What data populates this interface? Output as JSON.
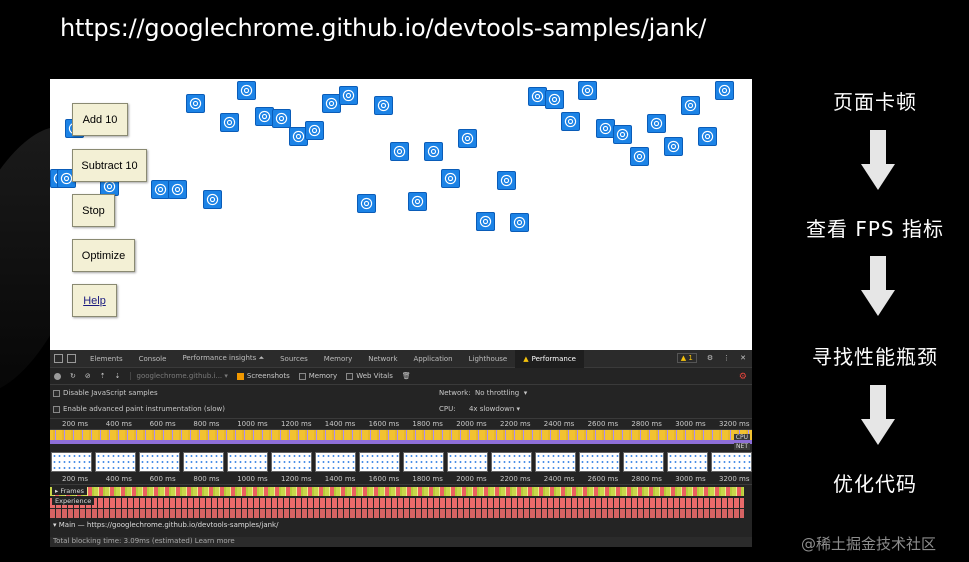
{
  "slide": {
    "url": "https://googlechrome.github.io/devtools-samples/jank/",
    "watermark": "@稀土掘金技术社区"
  },
  "demo": {
    "buttons": [
      "Add 10",
      "Subtract 10",
      "Stop",
      "Optimize",
      "Help"
    ]
  },
  "devtools": {
    "tabs": [
      "Elements",
      "Console",
      "Performance insights ⏶",
      "Sources",
      "Memory",
      "Network",
      "Application",
      "Lighthouse",
      "Performance"
    ],
    "active_tab": "Performance",
    "warning_count": "1",
    "toolbar": {
      "url_select": "googlechrome.github.i...",
      "screenshots": "Screenshots",
      "memory": "Memory",
      "web_vitals": "Web Vitals"
    },
    "options": {
      "disable_js_samples": "Disable JavaScript samples",
      "advanced_paint": "Enable advanced paint instrumentation (slow)",
      "network_label": "Network:",
      "network_value": "No throttling",
      "cpu_label": "CPU:",
      "cpu_value": "4x slowdown"
    },
    "ruler_ticks": [
      "200 ms",
      "400 ms",
      "600 ms",
      "800 ms",
      "1000 ms",
      "1200 ms",
      "1400 ms",
      "1600 ms",
      "1800 ms",
      "2000 ms",
      "2200 ms",
      "2400 ms",
      "2600 ms",
      "2800 ms",
      "3000 ms",
      "3200 ms"
    ],
    "cpu_tag": "CPU",
    "net_tag": "NET",
    "frames_label": "Frames",
    "experience_label": "Experience",
    "main_thread": "Main — https://googlechrome.github.io/devtools-samples/jank/",
    "blocking": "Total blocking time: 3.09ms (estimated) Learn more"
  },
  "flow": {
    "steps": [
      "页面卡顿",
      "查看 FPS 指标",
      "寻找性能瓶颈",
      "优化代码"
    ]
  }
}
